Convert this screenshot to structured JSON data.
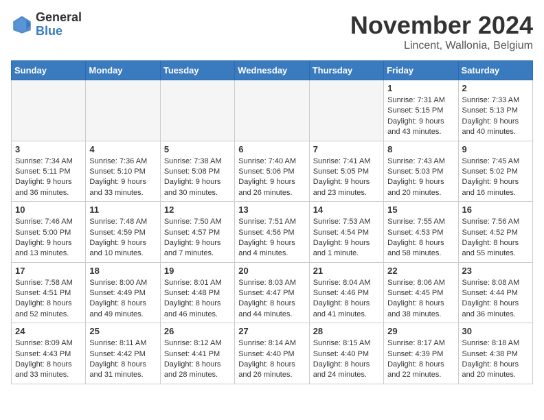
{
  "header": {
    "logo_general": "General",
    "logo_blue": "Blue",
    "month_title": "November 2024",
    "location": "Lincent, Wallonia, Belgium"
  },
  "weekdays": [
    "Sunday",
    "Monday",
    "Tuesday",
    "Wednesday",
    "Thursday",
    "Friday",
    "Saturday"
  ],
  "weeks": [
    [
      {
        "day": "",
        "info": ""
      },
      {
        "day": "",
        "info": ""
      },
      {
        "day": "",
        "info": ""
      },
      {
        "day": "",
        "info": ""
      },
      {
        "day": "",
        "info": ""
      },
      {
        "day": "1",
        "info": "Sunrise: 7:31 AM\nSunset: 5:15 PM\nDaylight: 9 hours and 43 minutes."
      },
      {
        "day": "2",
        "info": "Sunrise: 7:33 AM\nSunset: 5:13 PM\nDaylight: 9 hours and 40 minutes."
      }
    ],
    [
      {
        "day": "3",
        "info": "Sunrise: 7:34 AM\nSunset: 5:11 PM\nDaylight: 9 hours and 36 minutes."
      },
      {
        "day": "4",
        "info": "Sunrise: 7:36 AM\nSunset: 5:10 PM\nDaylight: 9 hours and 33 minutes."
      },
      {
        "day": "5",
        "info": "Sunrise: 7:38 AM\nSunset: 5:08 PM\nDaylight: 9 hours and 30 minutes."
      },
      {
        "day": "6",
        "info": "Sunrise: 7:40 AM\nSunset: 5:06 PM\nDaylight: 9 hours and 26 minutes."
      },
      {
        "day": "7",
        "info": "Sunrise: 7:41 AM\nSunset: 5:05 PM\nDaylight: 9 hours and 23 minutes."
      },
      {
        "day": "8",
        "info": "Sunrise: 7:43 AM\nSunset: 5:03 PM\nDaylight: 9 hours and 20 minutes."
      },
      {
        "day": "9",
        "info": "Sunrise: 7:45 AM\nSunset: 5:02 PM\nDaylight: 9 hours and 16 minutes."
      }
    ],
    [
      {
        "day": "10",
        "info": "Sunrise: 7:46 AM\nSunset: 5:00 PM\nDaylight: 9 hours and 13 minutes."
      },
      {
        "day": "11",
        "info": "Sunrise: 7:48 AM\nSunset: 4:59 PM\nDaylight: 9 hours and 10 minutes."
      },
      {
        "day": "12",
        "info": "Sunrise: 7:50 AM\nSunset: 4:57 PM\nDaylight: 9 hours and 7 minutes."
      },
      {
        "day": "13",
        "info": "Sunrise: 7:51 AM\nSunset: 4:56 PM\nDaylight: 9 hours and 4 minutes."
      },
      {
        "day": "14",
        "info": "Sunrise: 7:53 AM\nSunset: 4:54 PM\nDaylight: 9 hours and 1 minute."
      },
      {
        "day": "15",
        "info": "Sunrise: 7:55 AM\nSunset: 4:53 PM\nDaylight: 8 hours and 58 minutes."
      },
      {
        "day": "16",
        "info": "Sunrise: 7:56 AM\nSunset: 4:52 PM\nDaylight: 8 hours and 55 minutes."
      }
    ],
    [
      {
        "day": "17",
        "info": "Sunrise: 7:58 AM\nSunset: 4:51 PM\nDaylight: 8 hours and 52 minutes."
      },
      {
        "day": "18",
        "info": "Sunrise: 8:00 AM\nSunset: 4:49 PM\nDaylight: 8 hours and 49 minutes."
      },
      {
        "day": "19",
        "info": "Sunrise: 8:01 AM\nSunset: 4:48 PM\nDaylight: 8 hours and 46 minutes."
      },
      {
        "day": "20",
        "info": "Sunrise: 8:03 AM\nSunset: 4:47 PM\nDaylight: 8 hours and 44 minutes."
      },
      {
        "day": "21",
        "info": "Sunrise: 8:04 AM\nSunset: 4:46 PM\nDaylight: 8 hours and 41 minutes."
      },
      {
        "day": "22",
        "info": "Sunrise: 8:06 AM\nSunset: 4:45 PM\nDaylight: 8 hours and 38 minutes."
      },
      {
        "day": "23",
        "info": "Sunrise: 8:08 AM\nSunset: 4:44 PM\nDaylight: 8 hours and 36 minutes."
      }
    ],
    [
      {
        "day": "24",
        "info": "Sunrise: 8:09 AM\nSunset: 4:43 PM\nDaylight: 8 hours and 33 minutes."
      },
      {
        "day": "25",
        "info": "Sunrise: 8:11 AM\nSunset: 4:42 PM\nDaylight: 8 hours and 31 minutes."
      },
      {
        "day": "26",
        "info": "Sunrise: 8:12 AM\nSunset: 4:41 PM\nDaylight: 8 hours and 28 minutes."
      },
      {
        "day": "27",
        "info": "Sunrise: 8:14 AM\nSunset: 4:40 PM\nDaylight: 8 hours and 26 minutes."
      },
      {
        "day": "28",
        "info": "Sunrise: 8:15 AM\nSunset: 4:40 PM\nDaylight: 8 hours and 24 minutes."
      },
      {
        "day": "29",
        "info": "Sunrise: 8:17 AM\nSunset: 4:39 PM\nDaylight: 8 hours and 22 minutes."
      },
      {
        "day": "30",
        "info": "Sunrise: 8:18 AM\nSunset: 4:38 PM\nDaylight: 8 hours and 20 minutes."
      }
    ]
  ]
}
